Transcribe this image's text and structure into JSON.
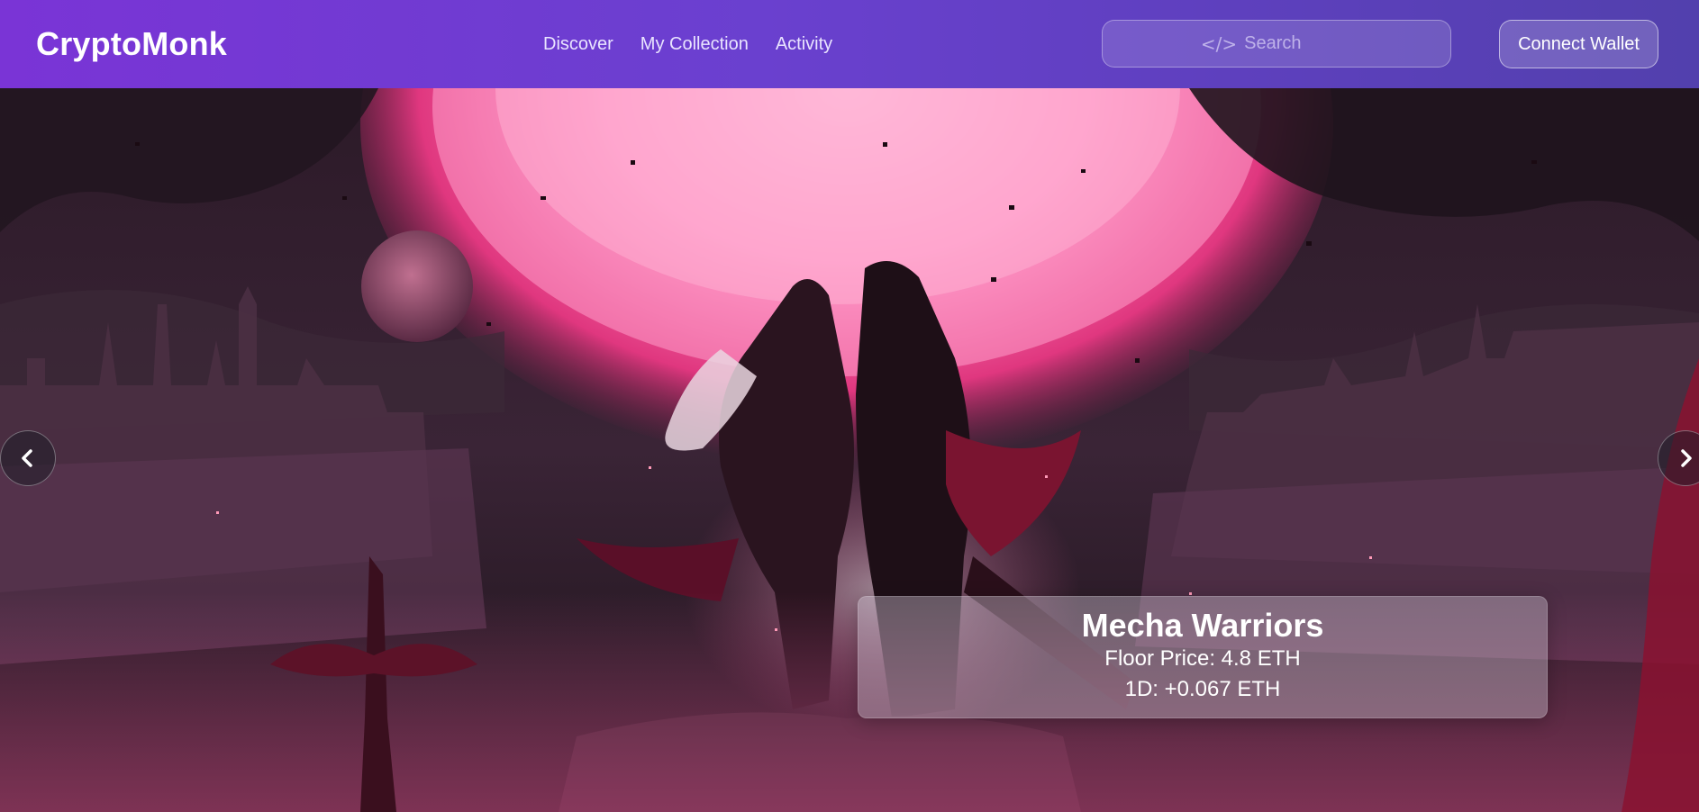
{
  "app": {
    "brand": "CryptoMonk"
  },
  "nav": {
    "links": [
      {
        "label": "Discover"
      },
      {
        "label": "My Collection"
      },
      {
        "label": "Activity"
      }
    ]
  },
  "search": {
    "icon": "</>",
    "placeholder": "Search"
  },
  "wallet": {
    "label": "Connect Wallet"
  },
  "hero": {
    "arrows": {
      "previous": "chevron-left-icon",
      "next": "chevron-right-icon"
    },
    "card": {
      "title": "Mecha Warriors",
      "floor": "Floor Price: 4.8 ETH",
      "change": "1D: +0.067 ETH"
    }
  },
  "colors": {
    "navbar_start": "#7a34d6",
    "navbar_end": "#5240ad",
    "moon": "#ff7ab6",
    "sky": "#2a1a2a"
  }
}
